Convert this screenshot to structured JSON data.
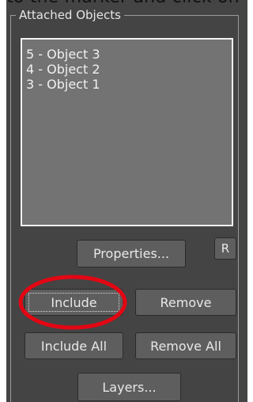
{
  "caption": {
    "cropped_text": "to the marker and click on"
  },
  "group": {
    "title": "Attached Objects"
  },
  "list": {
    "items": [
      {
        "label": "5 - Object 3"
      },
      {
        "label": "4 - Object 2"
      },
      {
        "label": "3 - Object 1"
      }
    ]
  },
  "buttons": {
    "properties": "Properties...",
    "r": "R",
    "include": "Include",
    "remove": "Remove",
    "include_all": "Include All",
    "remove_all": "Remove All",
    "layers": "Layers..."
  },
  "annotation": {
    "highlight_color": "#e30613",
    "highlight_target": "include-button"
  },
  "colors": {
    "panel_bg": "#444444",
    "listbox_bg": "#737373",
    "button_bg": "#5e5e5e",
    "text": "#e8e8e8"
  }
}
